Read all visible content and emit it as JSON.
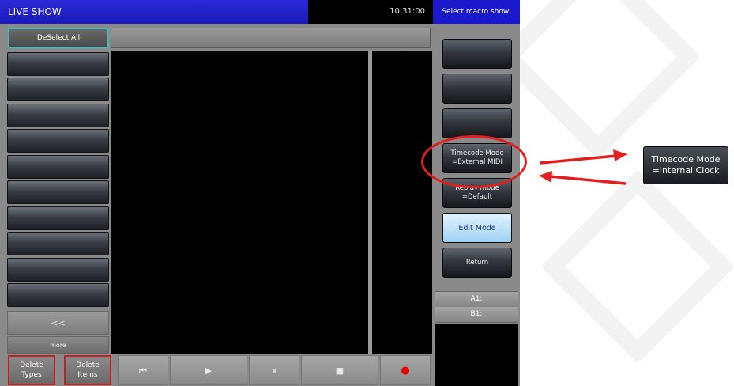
{
  "topbar": {
    "title": "LIVE SHOW",
    "time": "10:31:00",
    "macro_prompt": "Select macro show:"
  },
  "toolbar": {
    "deselect_label": "DeSelect All"
  },
  "sidebar": {
    "buttons": [
      "",
      "",
      "",
      "",
      "",
      "",
      "",
      "",
      "",
      ""
    ],
    "back_label": "<<",
    "more_label": "more"
  },
  "macro_panel": {
    "btn1": "",
    "btn2": "",
    "btn3": "",
    "timecode_line1": "Timecode Mode",
    "timecode_line2": "=External MIDI",
    "replay_line1": "Replay mode",
    "replay_line2": "=Default",
    "edit_mode": "Edit Mode",
    "return": "Return",
    "a1": "A1:",
    "b1": "B1:"
  },
  "bottombar": {
    "delete_types_1": "Delete",
    "delete_types_2": "Types",
    "delete_items_1": "Delete",
    "delete_items_2": "Items",
    "prev_icon": "⏮",
    "play_icon": "▶",
    "pause_icon": "⏸",
    "stop_icon": "■",
    "record_icon": "●"
  },
  "callout": {
    "line1": "Timecode Mode",
    "line2": "=Internal Clock"
  },
  "colors": {
    "annotation": "#e31e1e",
    "title_bar": "#2a2ad8",
    "edit_mode": "#9fd1f2"
  }
}
